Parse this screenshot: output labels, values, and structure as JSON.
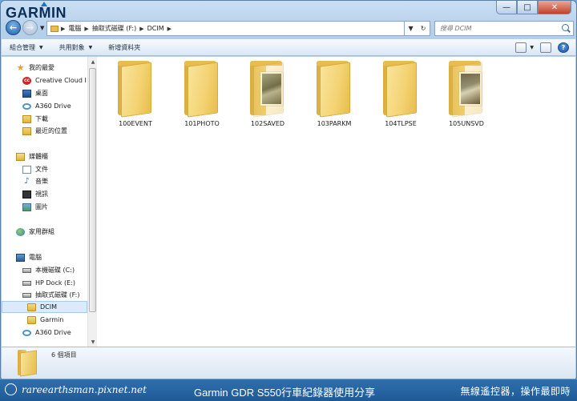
{
  "window": {
    "brand": "GARMIN"
  },
  "nav": {
    "breadcrumbs": [
      "電腦",
      "抽取式磁碟 (F:)",
      "DCIM"
    ]
  },
  "search": {
    "placeholder": "搜尋 DCIM"
  },
  "toolbar": {
    "organize": "組合管理",
    "share": "共用對象",
    "new_folder": "新增資料夾"
  },
  "sidebar": {
    "favorites": "我的最愛",
    "creative_cloud": "Creative Cloud I",
    "desktop": "桌面",
    "a360": "A360 Drive",
    "downloads": "下載",
    "recent": "最近的位置",
    "libraries": "媒體櫃",
    "documents": "文件",
    "music": "音樂",
    "videos": "視訊",
    "pictures": "圖片",
    "homegroup": "家用群組",
    "computer": "電腦",
    "drive_c": "本機磁碟 (C:)",
    "drive_e": "HP Dock (E:)",
    "drive_f": "抽取式磁碟 (F:)",
    "dcim": "DCIM",
    "garmin": "Garmin",
    "a360_2": "A360 Drive"
  },
  "folders": [
    {
      "name": "100EVENT",
      "thumbnail": false
    },
    {
      "name": "101PHOTO",
      "thumbnail": false
    },
    {
      "name": "102SAVED",
      "thumbnail": true
    },
    {
      "name": "103PARKM",
      "thumbnail": false
    },
    {
      "name": "104TLPSE",
      "thumbnail": false
    },
    {
      "name": "105UNSVD",
      "thumbnail": true
    }
  ],
  "details": {
    "count": "6 個項目"
  },
  "footer": {
    "site": "rareearthsman.pixnet.net",
    "title": "Garmin GDR S550行車紀錄器使用分享",
    "slogan": "無線遙控器，操作最即時"
  }
}
